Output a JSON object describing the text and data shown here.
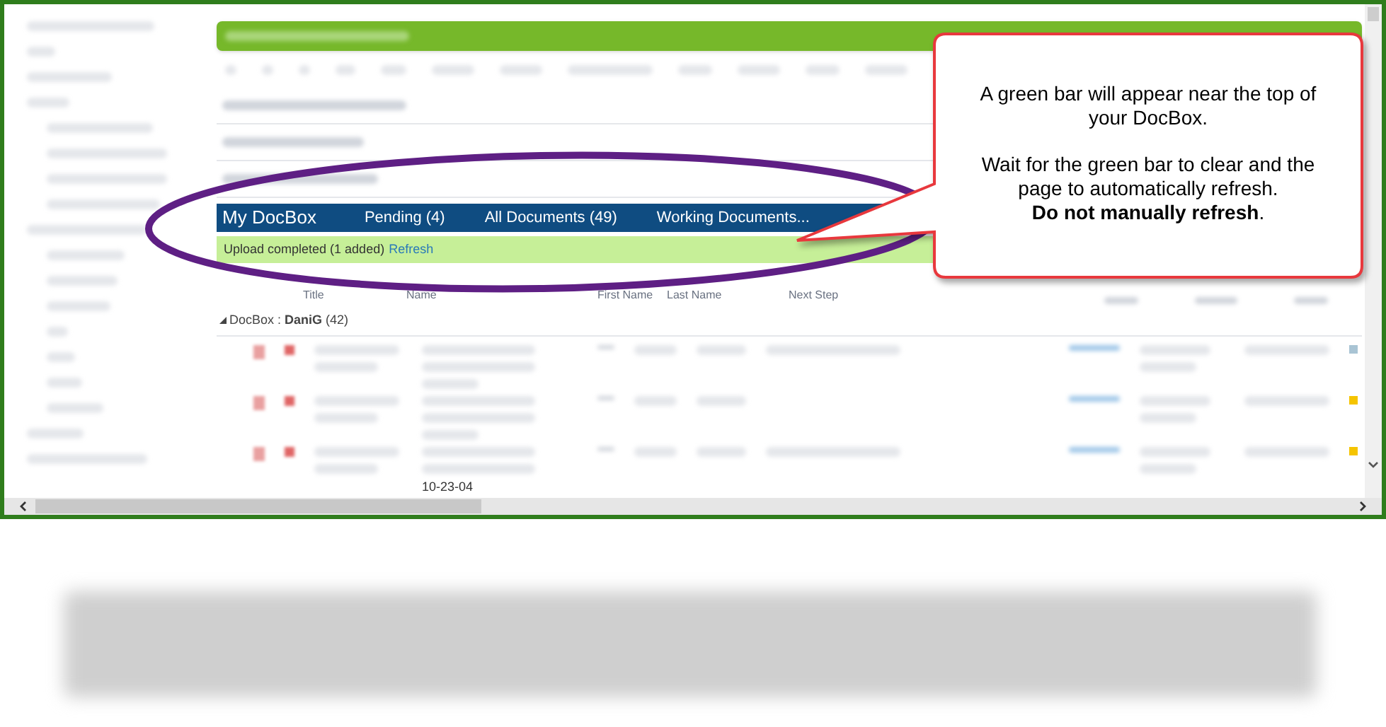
{
  "nav_bar": {
    "title": "My DocBox",
    "links": [
      "Pending (4)",
      "All Documents (49)",
      "Working Documents..."
    ]
  },
  "notification": {
    "message": "Upload completed (1 added)",
    "link": "Refresh"
  },
  "table": {
    "columns": [
      "Title",
      "Name",
      "First Name",
      "Last Name",
      "Next Step"
    ],
    "group": {
      "label": "DocBox : **DaniG** (42)",
      "expanded": true
    },
    "visible_cell": "10-23-04"
  },
  "callout": {
    "paragraphs": [
      "A green bar will appear near the top of your DocBox.",
      "Wait for the green bar to clear and the page to automatically refresh.",
      "**Do not manually refresh**."
    ]
  }
}
